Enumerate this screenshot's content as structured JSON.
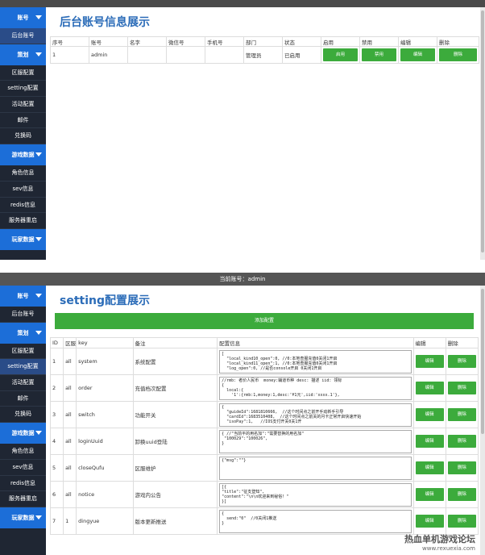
{
  "panel1": {
    "sidebar": [
      {
        "type": "head",
        "label": "账号"
      },
      {
        "type": "item",
        "label": "后台账号",
        "active": true
      },
      {
        "type": "head",
        "label": "策划"
      },
      {
        "type": "item",
        "label": "区服配置"
      },
      {
        "type": "item",
        "label": "setting配置"
      },
      {
        "type": "item",
        "label": "活动配置"
      },
      {
        "type": "item",
        "label": "邮件"
      },
      {
        "type": "item",
        "label": "兑换码"
      },
      {
        "type": "head",
        "label": "游戏数据"
      },
      {
        "type": "item",
        "label": "角色信息"
      },
      {
        "type": "item",
        "label": "sev信息"
      },
      {
        "type": "item",
        "label": "redis信息"
      },
      {
        "type": "item",
        "label": "服务器重启"
      },
      {
        "type": "head",
        "label": "玩家数据"
      }
    ],
    "title": "后台账号信息展示",
    "headers": [
      "序号",
      "账号",
      "名字",
      "微信号",
      "手机号",
      "部门",
      "状态",
      "启用",
      "禁用",
      "编辑",
      "删除"
    ],
    "rows": [
      {
        "no": "1",
        "account": "admin",
        "name": "",
        "wechat": "",
        "phone": "",
        "dept": "管理员",
        "status": "已启用",
        "enable": "启用",
        "disable": "禁用",
        "edit": "编辑",
        "delete": "删除"
      }
    ]
  },
  "panel2": {
    "current_account": "当前账号：admin",
    "sidebar": [
      {
        "type": "head",
        "label": "账号"
      },
      {
        "type": "item",
        "label": "后台账号"
      },
      {
        "type": "head",
        "label": "策划"
      },
      {
        "type": "item",
        "label": "区服配置"
      },
      {
        "type": "item",
        "label": "setting配置",
        "active": true
      },
      {
        "type": "item",
        "label": "活动配置"
      },
      {
        "type": "item",
        "label": "邮件"
      },
      {
        "type": "item",
        "label": "兑换码"
      },
      {
        "type": "head",
        "label": "游戏数据"
      },
      {
        "type": "item",
        "label": "角色信息"
      },
      {
        "type": "item",
        "label": "sev信息"
      },
      {
        "type": "item",
        "label": "redis信息"
      },
      {
        "type": "item",
        "label": "服务器重启"
      },
      {
        "type": "head",
        "label": "玩家数据"
      }
    ],
    "title": "setting配置展示",
    "add_label": "添加配置",
    "headers": [
      "ID",
      "区服",
      "key",
      "备注",
      "配置信息",
      "编辑",
      "删除"
    ],
    "rows": [
      {
        "id": "1",
        "server": "all",
        "key": "system",
        "note": "系统配置",
        "config": "[\n  \"local_kind10_open\":0, //0:本地查服充值0关闭1开启\n  \"local_kind11_open\":1, //0:本地查服充值0关闭1开启\n  \"log_open\":0, //是否console开启 0关闭1开启",
        "edit": "编辑",
        "delete": "删除"
      },
      {
        "id": "2",
        "server": "all",
        "key": "order",
        "note": "充值档次配置",
        "config": "//rmb: 者价人民币  money:辅道币种 desc: 描述 iid: 领标\n{\n  local:{\n    '1':{rmb:1,money:1,desc:'¥1元',iid:'xxxx.1'},",
        "edit": "编辑",
        "delete": "删除"
      },
      {
        "id": "3",
        "server": "all",
        "key": "switch",
        "note": "功能开关",
        "config": "{\n  \"guideId\":1681810666,  //这个时间点之前开手动新手引导\n  \"cardId\":1683510408,  //这个时间点之前关的月卡正常开启快速开始\n  \"isoPay\":1,   //IOS支付开关0关1开",
        "edit": "编辑",
        "delete": "删除"
      },
      {
        "id": "4",
        "server": "all",
        "key": "loginUuid",
        "note": "卸换uuid登陆",
        "config": "{ //\"当前平的用名加\":\"需要替换的用名加\"\n \"100029\":\"100026\",\n}",
        "edit": "编辑",
        "delete": "删除"
      },
      {
        "id": "5",
        "server": "all",
        "key": "closeQufu",
        "note": "区服维护",
        "config": "{\"msg\":\"\"}",
        "edit": "编辑",
        "delete": "删除"
      },
      {
        "id": "6",
        "server": "all",
        "key": "notice",
        "note": "游戏内公告",
        "config": "[{\n\"title\":\"征支登知\",\n\"content\":\"\\n\\n欢迎来到秘俗！\"\n}]",
        "edit": "编辑",
        "delete": "删除"
      },
      {
        "id": "7",
        "server": "1",
        "key": "dingyue",
        "note": "版本更新推送",
        "config": "{\n  send:\"0\"  //0关闭1推送\n}",
        "edit": "编辑",
        "delete": "删除"
      }
    ]
  },
  "watermark": {
    "line1": "热血单机游戏论坛",
    "line2": "www.rexuexia.com"
  }
}
